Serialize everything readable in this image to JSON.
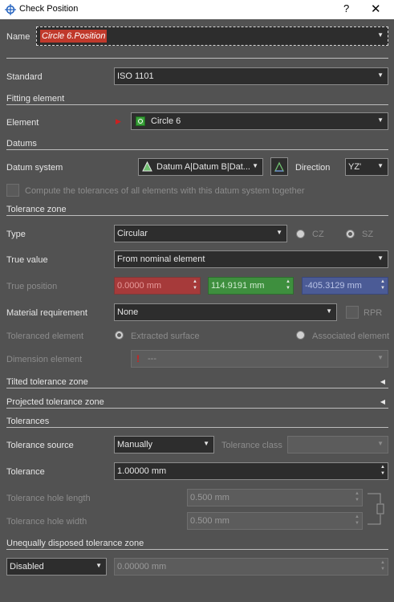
{
  "window": {
    "title": "Check Position",
    "help": "?",
    "close": "✕"
  },
  "name": {
    "label": "Name",
    "value": "Circle 6.Position"
  },
  "standard": {
    "label": "Standard",
    "value": "ISO 1101"
  },
  "fitting_element": {
    "header": "Fitting element",
    "label": "Element",
    "value": "Circle 6"
  },
  "datums": {
    "header": "Datums",
    "system_label": "Datum system",
    "system_value": "Datum A|Datum B|Dat...",
    "direction_label": "Direction",
    "direction_value": "YZ'",
    "compute_label": "Compute the tolerances of all elements with this datum system together"
  },
  "tolerance_zone": {
    "header": "Tolerance zone",
    "type_label": "Type",
    "type_value": "Circular",
    "cz_label": "CZ",
    "sz_label": "SZ",
    "true_value_label": "True value",
    "true_value_value": "From nominal element",
    "true_position_label": "True position",
    "true_position_x": "0.0000 mm",
    "true_position_y": "114.9191 mm",
    "true_position_z": "-405.3129 mm",
    "material_label": "Material requirement",
    "material_value": "None",
    "rpr_label": "RPR",
    "toleranced_label": "Toleranced element",
    "extracted_label": "Extracted surface",
    "associated_label": "Associated element",
    "dimension_label": "Dimension element",
    "dimension_value": "---"
  },
  "tilted": {
    "header": "Tilted tolerance zone"
  },
  "projected": {
    "header": "Projected tolerance zone"
  },
  "tolerances": {
    "header": "Tolerances",
    "source_label": "Tolerance source",
    "source_value": "Manually",
    "class_label": "Tolerance class",
    "tolerance_label": "Tolerance",
    "tolerance_value": "1.00000 mm",
    "hole_length_label": "Tolerance hole length",
    "hole_length_value": "0.500 mm",
    "hole_width_label": "Tolerance hole width",
    "hole_width_value": "0.500 mm"
  },
  "unequal": {
    "header": "Unequally disposed tolerance zone",
    "mode_value": "Disabled",
    "offset_value": "0.00000 mm"
  },
  "colors": {
    "background": "#525252",
    "name_field": "#c0392b",
    "x_field": "#a63a3a",
    "y_field": "#3e8f3e",
    "z_field": "#4b5b96"
  },
  "icons": [
    "crosshair-icon",
    "red-arrow-icon",
    "circle-element-icon",
    "datum-system-icon",
    "direction-icon",
    "exclamation-icon",
    "link-bracket-icon"
  ]
}
